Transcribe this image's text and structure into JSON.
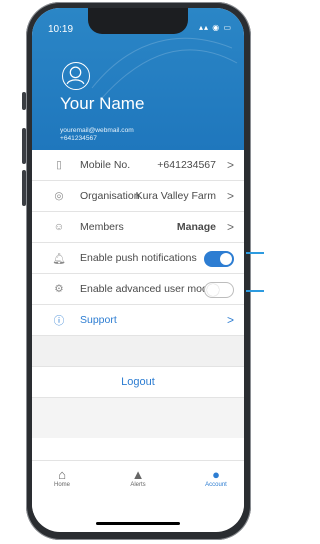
{
  "status": {
    "time": "10:19",
    "icons": "▴▴ ◉ ▭"
  },
  "profile": {
    "name": "Your Name",
    "email": "youremail@webmail.com",
    "phone": "+641234567"
  },
  "rows": [
    {
      "icon": "mobile-icon",
      "label": "Mobile No.",
      "value": "+641234567",
      "chevron": ">"
    },
    {
      "icon": "location-icon",
      "label": "Organisation",
      "value": "Kura Valley Farm",
      "chevron": ">"
    },
    {
      "icon": "members-icon",
      "label": "Members",
      "value": "Manage",
      "chevron": ">"
    },
    {
      "icon": "bell-icon",
      "label": "Enable push notifications",
      "toggle": "on"
    },
    {
      "icon": "advanced-user-icon",
      "label": "Enable advanced user mode",
      "toggle": "off"
    },
    {
      "icon": "question-icon",
      "label": "Support",
      "chevron": ">"
    }
  ],
  "logout": "Logout",
  "tabs": [
    {
      "label": "Home",
      "icon": "home-icon"
    },
    {
      "label": "Alerts",
      "icon": "alert-icon"
    },
    {
      "label": "Account",
      "icon": "account-icon",
      "active": true
    }
  ],
  "colors": {
    "brand": "#1f77bd",
    "accent": "#2d7dd2",
    "callout": "#2d9be0"
  }
}
